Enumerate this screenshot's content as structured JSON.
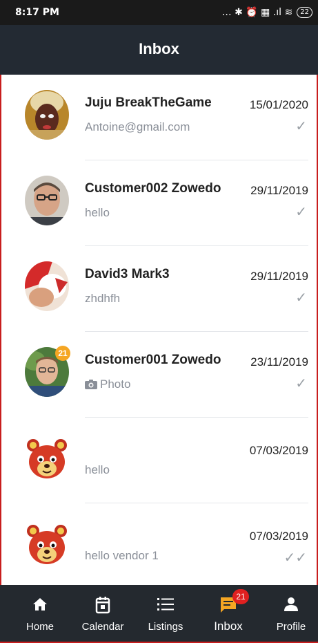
{
  "status_bar": {
    "time": "8:17 PM",
    "icons": "… ✱ ⏰ ▦ .ıl ≋",
    "battery": "22"
  },
  "header": {
    "title": "Inbox"
  },
  "conversations": [
    {
      "name": "Juju BreakTheGame",
      "preview": "Antoine@gmail.com",
      "date": "15/01/2020",
      "status_icon": "single-check"
    },
    {
      "name": "Customer002 Zowedo",
      "preview": "hello",
      "date": "29/11/2019",
      "status_icon": "single-check"
    },
    {
      "name": "David3 Mark3",
      "preview": "zhdhfh",
      "date": "29/11/2019",
      "status_icon": "single-check"
    },
    {
      "name": "Customer001 Zowedo",
      "preview": "Photo",
      "date": "23/11/2019",
      "status_icon": "single-check",
      "badge": "21"
    },
    {
      "name": "",
      "preview": "hello",
      "date": "07/03/2019",
      "status_icon": "none"
    },
    {
      "name": "",
      "preview": "hello vendor 1",
      "date": "07/03/2019",
      "status_icon": "double-check"
    }
  ],
  "tabbar": {
    "home": "Home",
    "calendar": "Calendar",
    "listings": "Listings",
    "inbox": "Inbox",
    "inbox_badge": "21",
    "profile": "Profile"
  },
  "colors": {
    "header_bg": "#232a33",
    "tabbar_bg": "#24292f",
    "inbox_accent": "#f5a623",
    "badge_red": "#e02020"
  }
}
